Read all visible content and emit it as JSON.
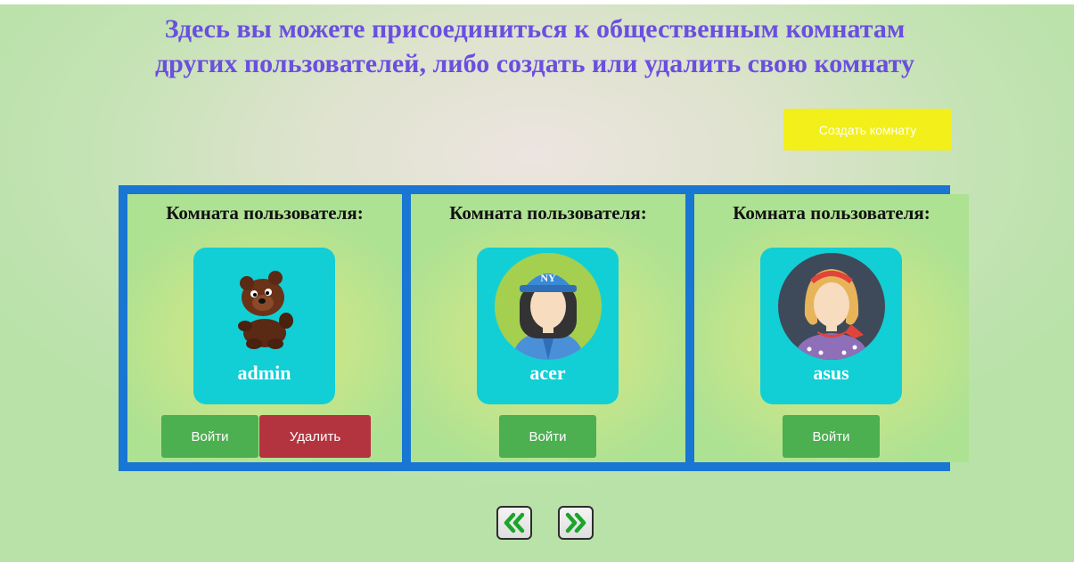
{
  "header": {
    "line1": "Здесь вы можете присоединиться к общественным комнатам",
    "line2": "других пользователей, либо создать или удалить свою комнату"
  },
  "create_button_label": "Создать комнату",
  "rooms": [
    {
      "title": "Комната пользователя:",
      "username": "admin",
      "avatar_icon": "bear-avatar-icon",
      "enter_label": "Войти",
      "delete_label": "Удалить"
    },
    {
      "title": "Комната пользователя:",
      "username": "acer",
      "avatar_icon": "woman-cap-avatar-icon",
      "enter_label": "Войти"
    },
    {
      "title": "Комната пользователя:",
      "username": "asus",
      "avatar_icon": "woman-scarf-avatar-icon",
      "enter_label": "Войти"
    }
  ],
  "pagination": {
    "prev_icon": "double-chevron-left-icon",
    "next_icon": "double-chevron-right-icon"
  },
  "colors": {
    "heading": "#6a4fe0",
    "create_button": "#f2ef1a",
    "rooms_border": "#1976d2",
    "card": "#12cfd6",
    "enter_button": "#4caf50",
    "delete_button": "#b3343f",
    "pager_arrow": "#1aa52a"
  }
}
